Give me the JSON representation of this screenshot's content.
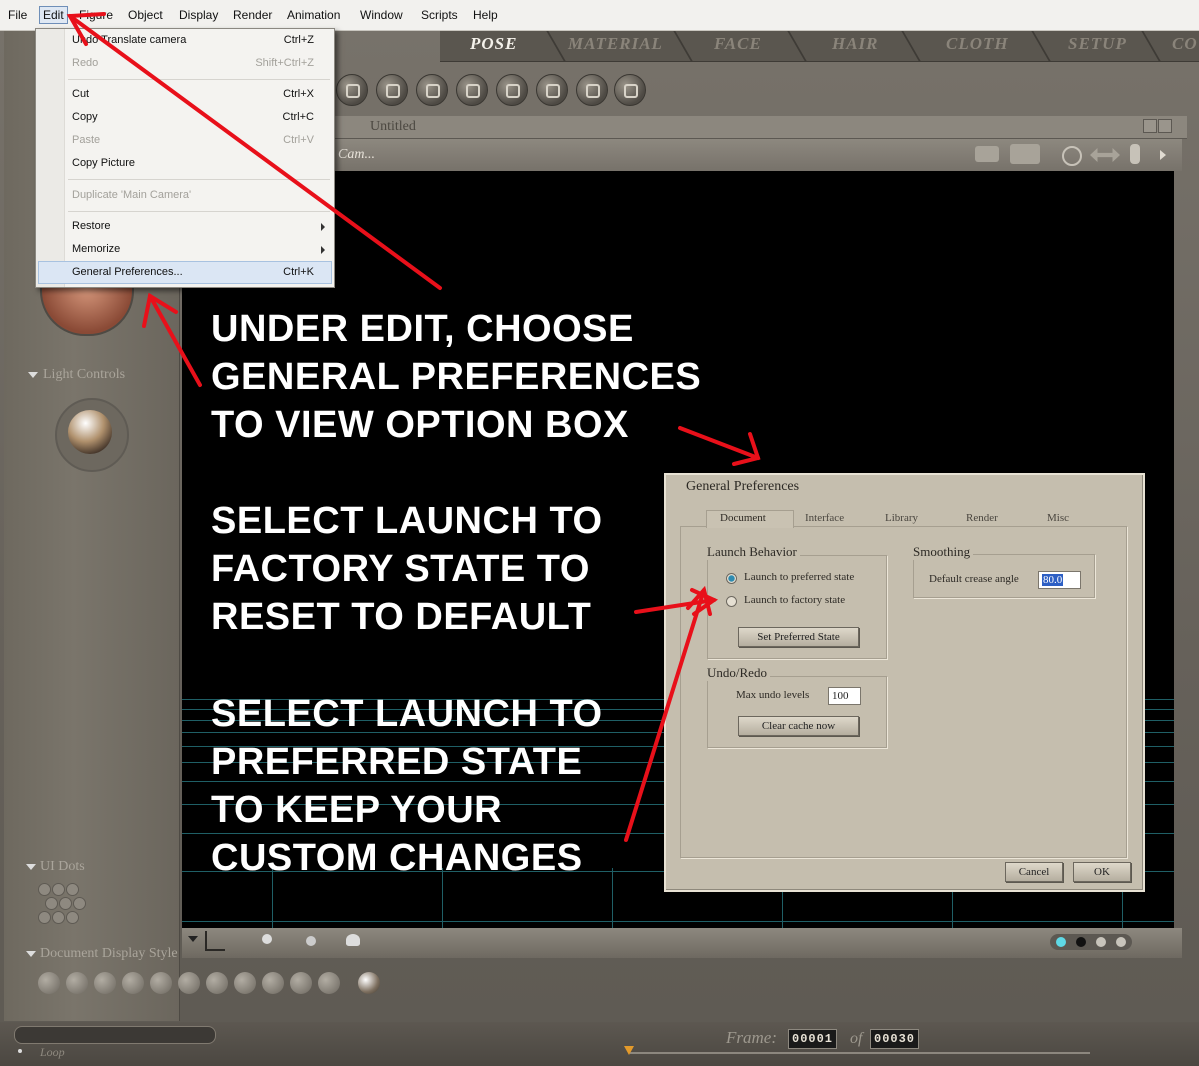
{
  "menubar": {
    "items": [
      "File",
      "Edit",
      "Figure",
      "Object",
      "Display",
      "Render",
      "Animation",
      "Window",
      "Scripts",
      "Help"
    ]
  },
  "room_tabs": [
    "POSE",
    "MATERIAL",
    "FACE",
    "HAIR",
    "CLOTH",
    "SETUP",
    "CO"
  ],
  "document": {
    "title": "Untitled",
    "camera_label": "Cam..."
  },
  "edit_menu": {
    "undo": {
      "label": "Undo Translate camera",
      "shortcut": "Ctrl+Z"
    },
    "redo": {
      "label": "Redo",
      "shortcut": "Shift+Ctrl+Z"
    },
    "cut": {
      "label": "Cut",
      "shortcut": "Ctrl+X"
    },
    "copy": {
      "label": "Copy",
      "shortcut": "Ctrl+C"
    },
    "paste": {
      "label": "Paste",
      "shortcut": "Ctrl+V"
    },
    "copy_picture": {
      "label": "Copy Picture"
    },
    "duplicate": {
      "label": "Duplicate 'Main Camera'"
    },
    "restore": {
      "label": "Restore"
    },
    "memorize": {
      "label": "Memorize"
    },
    "general_prefs": {
      "label": "General Preferences...",
      "shortcut": "Ctrl+K"
    }
  },
  "instructions": {
    "block1": [
      "UNDER EDIT, CHOOSE",
      "GENERAL PREFERENCES",
      "TO VIEW OPTION BOX"
    ],
    "block2": [
      "SELECT LAUNCH TO",
      "FACTORY STATE TO",
      "RESET TO DEFAULT"
    ],
    "block3": [
      "SELECT LAUNCH TO",
      "PREFERRED STATE",
      "TO KEEP YOUR",
      "CUSTOM CHANGES"
    ]
  },
  "prefs": {
    "title": "General Preferences",
    "tabs": [
      "Document",
      "Interface",
      "Library",
      "Render",
      "Misc"
    ],
    "launch_group": "Launch Behavior",
    "launch_preferred": "Launch to preferred state",
    "launch_factory": "Launch to factory state",
    "set_preferred_button": "Set Preferred State",
    "smoothing_group": "Smoothing",
    "crease_label": "Default crease angle",
    "crease_value": "80.0",
    "undo_group": "Undo/Redo",
    "max_undo_label": "Max undo levels",
    "max_undo_value": "100",
    "clear_cache_button": "Clear cache now",
    "cancel_button": "Cancel",
    "ok_button": "OK"
  },
  "left_panel": {
    "light_controls": "Light Controls",
    "ui_dots": "UI Dots",
    "doc_display_style": "Document Display Style"
  },
  "animation": {
    "frame_label": "Frame:",
    "current_frame": "00001",
    "of_label": "of",
    "total_frames": "00030",
    "loop_label": "Loop"
  },
  "colors": {
    "annotation_arrow": "#e8101a",
    "instruction_text": "#ffffff",
    "viewport_bg": "#000000",
    "grid": "#1f5f66"
  }
}
